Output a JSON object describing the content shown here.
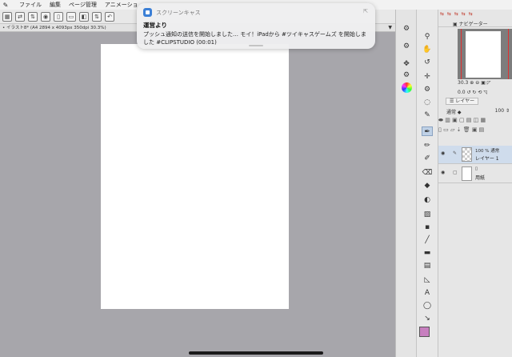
{
  "menubar": {
    "items": [
      "ファイル",
      "編集",
      "ページ管理",
      "アニメーショ"
    ]
  },
  "document_tab": {
    "label": "• イラスト8* (A4 2894 x 4093px 350dpi 30.3%)"
  },
  "notification": {
    "app_name": "スクリーンキャス",
    "title": "運営より",
    "body": "プッシュ通知の送信を開始しました… モイ！iPadから #ツイキャスゲームズ を開始しました #CLIPSTUDIO (00:01)"
  },
  "navigator": {
    "tab_label": "ナビゲーター",
    "zoom": "30.3",
    "angle": "0.0"
  },
  "layer_panel": {
    "tab_label": "レイヤー",
    "blend_mode": "通常",
    "opacity": "100",
    "layers": [
      {
        "line1": "100 % 通常",
        "name": "レイヤー 1"
      },
      {
        "line1": "",
        "name": "用紙"
      }
    ]
  },
  "colors": {
    "main_color": "#c77fbf",
    "sub_color": "#ffffff",
    "canvas_bg": "#a7a6ab"
  }
}
